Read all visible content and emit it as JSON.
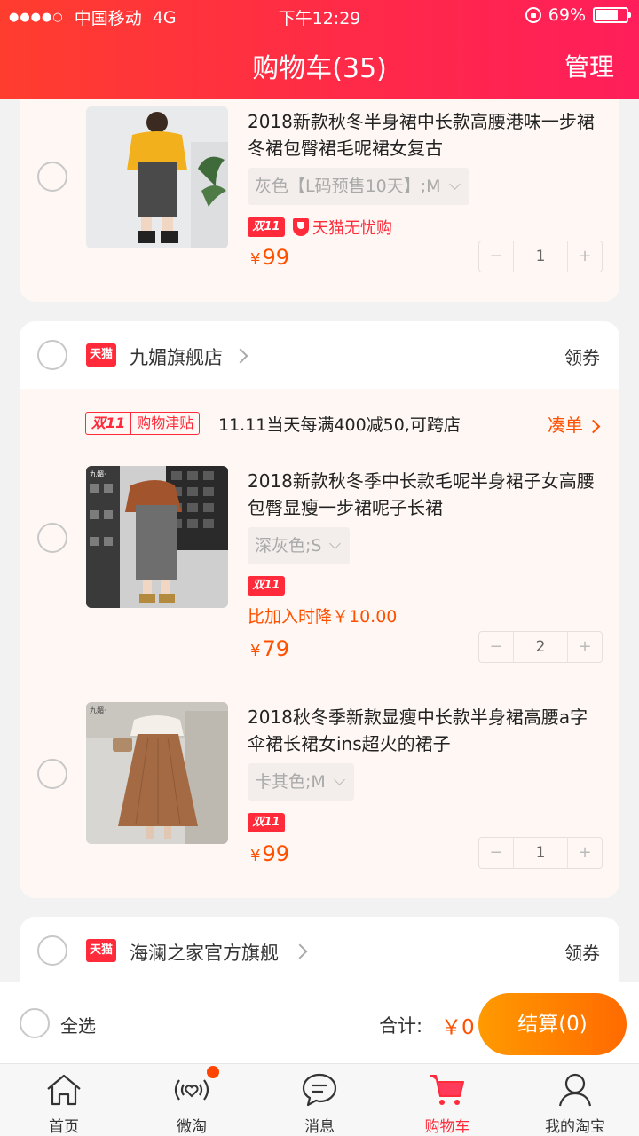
{
  "status": {
    "carrier": "中国移动",
    "network": "4G",
    "time": "下午12:29",
    "battery": "69%"
  },
  "header": {
    "title": "购物车(35)",
    "manage": "管理"
  },
  "first_item": {
    "title": "2018新款秋冬半身裙中长款高腰港味一步裙冬裙包臀裙毛呢裙女复古",
    "spec": "灰色【L码预售10天】;M",
    "badge_d11": "双11",
    "badge_worry": "天猫无忧购",
    "price_symbol": "¥",
    "price": "99",
    "qty": "1"
  },
  "store2": {
    "tmall": "天猫",
    "name": "九媚旗舰店",
    "coupon": "领券",
    "promo_d": "双11",
    "promo_t": "购物津贴",
    "promo_text": "11.11当天每满400减50,可跨店",
    "promo_link": "凑单",
    "items": [
      {
        "title": "2018新款秋冬季中长款毛呢半身裙子女高腰包臀显瘦一步裙呢子长裙",
        "spec": "深灰色;S",
        "badge_d11": "双11",
        "price_drop": "比加入时降￥10.00",
        "price_symbol": "¥",
        "price": "79",
        "qty": "2"
      },
      {
        "title": "2018秋冬季新款显瘦中长款半身裙高腰a字伞裙长裙女ins超火的裙子",
        "spec": "卡其色;M",
        "badge_d11": "双11",
        "price_symbol": "¥",
        "price": "99",
        "qty": "1"
      }
    ]
  },
  "store3": {
    "tmall": "天猫",
    "name": "海澜之家官方旗舰",
    "coupon": "领券"
  },
  "checkout": {
    "select_all": "全选",
    "total_label": "合计:",
    "total_value": "￥0",
    "button": "结算(0)"
  },
  "tabs": [
    {
      "label": "首页",
      "icon": "home-icon"
    },
    {
      "label": "微淘",
      "icon": "weitao-icon"
    },
    {
      "label": "消息",
      "icon": "message-icon"
    },
    {
      "label": "购物车",
      "icon": "cart-icon"
    },
    {
      "label": "我的淘宝",
      "icon": "profile-icon"
    }
  ],
  "colors": {
    "header": "#ff2a48",
    "accent": "#ff5000",
    "tmall_red": "#ff2a3a",
    "checkout": "#ff7a00"
  }
}
